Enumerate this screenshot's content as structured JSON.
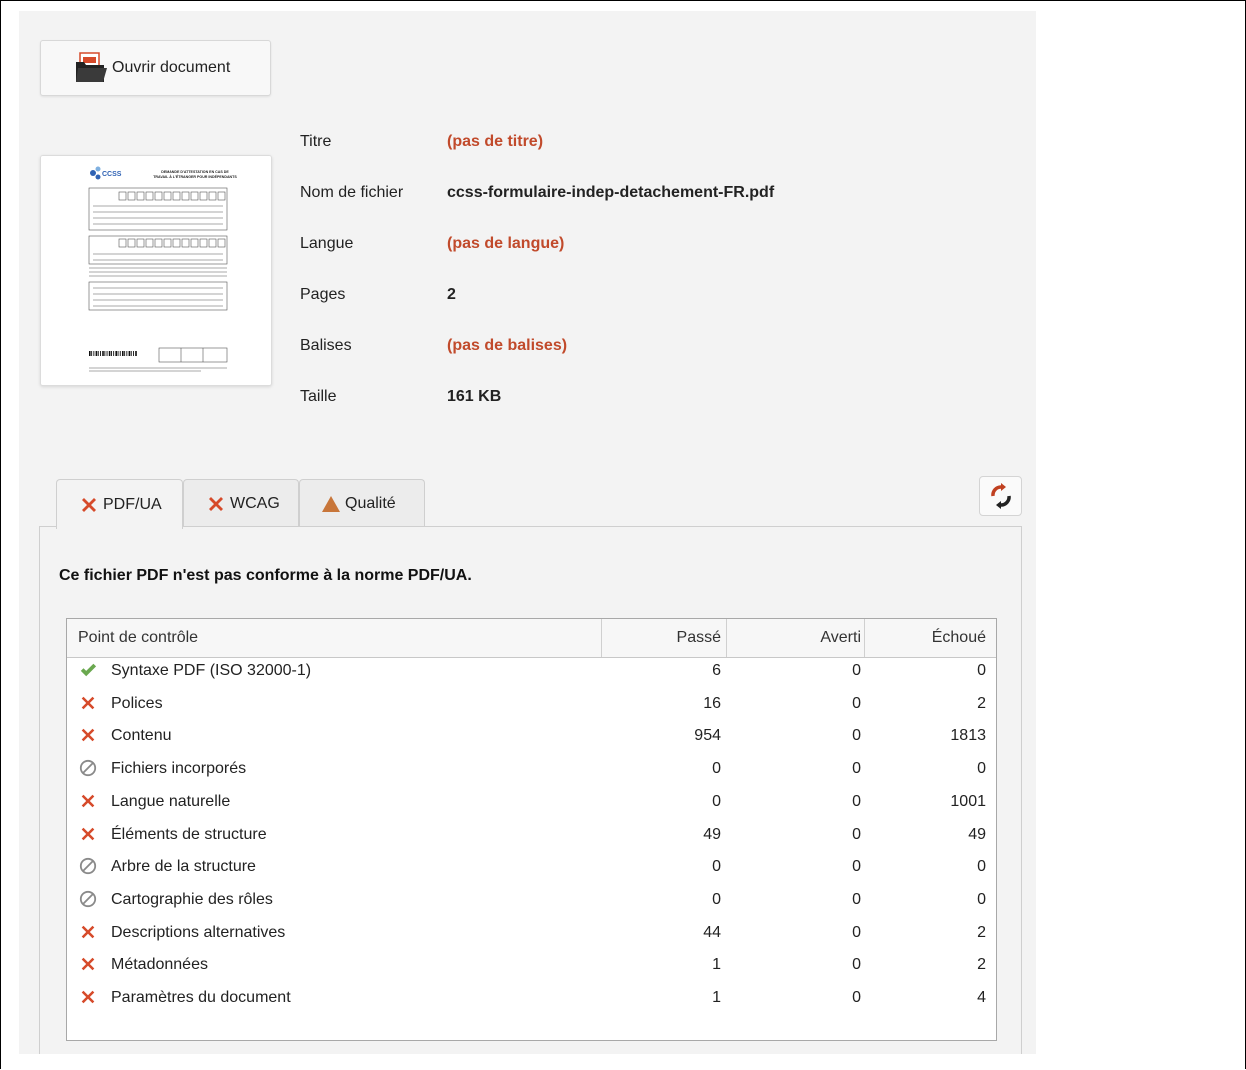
{
  "toolbar": {
    "open_label": "Ouvrir document"
  },
  "thumbnail": {
    "brand": "CCSS",
    "title_line1": "DEMANDE D'ATTESTATION EN CAS DE",
    "title_line2": "TRAVAIL À L'ÉTRANGER POUR INDÉPENDANTS"
  },
  "properties": [
    {
      "key": "Titre",
      "value": "(pas de titre)",
      "missing": true
    },
    {
      "key": "Nom de fichier",
      "value": "ccss-formulaire-indep-detachement-FR.pdf",
      "missing": false
    },
    {
      "key": "Langue",
      "value": "(pas de langue)",
      "missing": true
    },
    {
      "key": "Pages",
      "value": "2",
      "missing": false
    },
    {
      "key": "Balises",
      "value": "(pas de balises)",
      "missing": true
    },
    {
      "key": "Taille",
      "value": "161 KB",
      "missing": false
    }
  ],
  "tabs": [
    {
      "label": "PDF/UA",
      "status": "fail",
      "active": true
    },
    {
      "label": "WCAG",
      "status": "fail",
      "active": false
    },
    {
      "label": "Qualité",
      "status": "warning",
      "active": false
    }
  ],
  "summary": "Ce fichier PDF n'est pas conforme à la norme PDF/UA.",
  "table": {
    "headers": [
      "Point de contrôle",
      "Passé",
      "Averti",
      "Échoué"
    ],
    "rows": [
      {
        "status": "pass",
        "name": "Syntaxe PDF (ISO 32000-1)",
        "passed": "6",
        "warned": "0",
        "failed": "0"
      },
      {
        "status": "fail",
        "name": "Polices",
        "passed": "16",
        "warned": "0",
        "failed": "2"
      },
      {
        "status": "fail",
        "name": "Contenu",
        "passed": "954",
        "warned": "0",
        "failed": "1813"
      },
      {
        "status": "na",
        "name": "Fichiers incorporés",
        "passed": "0",
        "warned": "0",
        "failed": "0"
      },
      {
        "status": "fail",
        "name": "Langue naturelle",
        "passed": "0",
        "warned": "0",
        "failed": "1001"
      },
      {
        "status": "fail",
        "name": "Éléments de structure",
        "passed": "49",
        "warned": "0",
        "failed": "49"
      },
      {
        "status": "na",
        "name": "Arbre de la structure",
        "passed": "0",
        "warned": "0",
        "failed": "0"
      },
      {
        "status": "na",
        "name": "Cartographie des rôles",
        "passed": "0",
        "warned": "0",
        "failed": "0"
      },
      {
        "status": "fail",
        "name": "Descriptions alternatives",
        "passed": "44",
        "warned": "0",
        "failed": "2"
      },
      {
        "status": "fail",
        "name": "Métadonnées",
        "passed": "1",
        "warned": "0",
        "failed": "2"
      },
      {
        "status": "fail",
        "name": "Paramètres du document",
        "passed": "1",
        "warned": "0",
        "failed": "4"
      }
    ]
  },
  "colors": {
    "fail": "#d64a2a",
    "pass": "#6aa84f",
    "warning": "#c8763a",
    "na": "#8a8a8a",
    "missing_value": "#c14a2b",
    "brand_blue": "#2f62b4"
  },
  "icons": {
    "open": "folder-pdf-icon",
    "fail": "cross-icon",
    "pass": "check-icon",
    "warning": "warning-triangle-icon",
    "na": "not-applicable-icon",
    "refresh": "refresh-icon"
  }
}
